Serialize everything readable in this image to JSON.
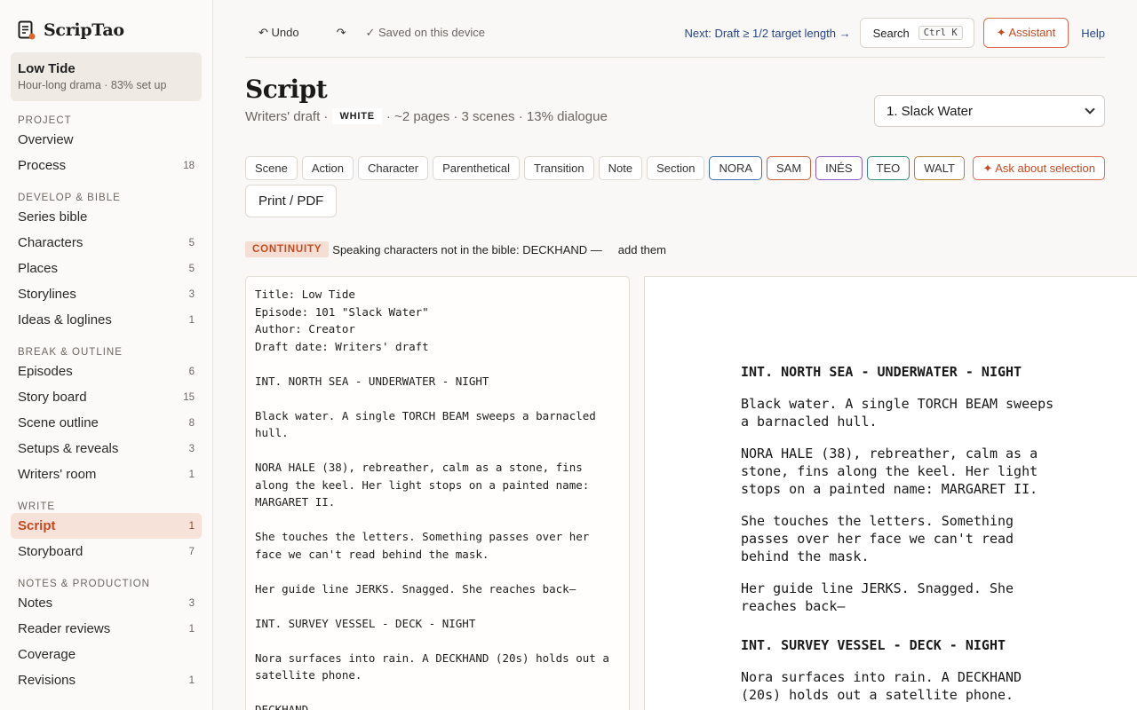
{
  "brand": {
    "name": "ScripTao",
    "accent": "#c44a21"
  },
  "project": {
    "title": "Low Tide",
    "subtitle": "Hour-long drama · 83% set up"
  },
  "nav": [
    {
      "section": "Project",
      "items": [
        {
          "label": "Overview",
          "count": ""
        },
        {
          "label": "Process",
          "count": "18"
        }
      ]
    },
    {
      "section": "Develop & Bible",
      "items": [
        {
          "label": "Series bible",
          "count": ""
        },
        {
          "label": "Characters",
          "count": "5"
        },
        {
          "label": "Places",
          "count": "5"
        },
        {
          "label": "Storylines",
          "count": "3"
        },
        {
          "label": "Ideas & loglines",
          "count": "1"
        }
      ]
    },
    {
      "section": "Break & Outline",
      "items": [
        {
          "label": "Episodes",
          "count": "6"
        },
        {
          "label": "Story board",
          "count": "15"
        },
        {
          "label": "Scene outline",
          "count": "8"
        },
        {
          "label": "Setups & reveals",
          "count": "3"
        },
        {
          "label": "Writers' room",
          "count": "1"
        }
      ]
    },
    {
      "section": "Write",
      "items": [
        {
          "label": "Script",
          "count": "1",
          "active": true
        },
        {
          "label": "Storyboard",
          "count": "7"
        }
      ]
    },
    {
      "section": "Notes & Production",
      "items": [
        {
          "label": "Notes",
          "count": "3"
        },
        {
          "label": "Reader reviews",
          "count": "1"
        },
        {
          "label": "Coverage",
          "count": ""
        },
        {
          "label": "Revisions",
          "count": "1"
        }
      ]
    }
  ],
  "topbar": {
    "undo": "↶ Undo",
    "redo": "↷",
    "saved": "✓ Saved on this device",
    "next": "Next: Draft ≥ 1/2 target length →",
    "search": "Search",
    "search_kbd": "Ctrl K",
    "assistant": "✦ Assistant",
    "help": "Help"
  },
  "page": {
    "title": "Script",
    "draft": "Writers' draft ·",
    "revision": "WHITE",
    "stats": "· ~2 pages · 3 scenes · 13% dialogue",
    "scene_selected": "1. Slack Water"
  },
  "toolbar": {
    "elements": [
      "Scene",
      "Action",
      "Character",
      "Parenthetical",
      "Transition",
      "Note",
      "Section"
    ],
    "characters": [
      {
        "name": "NORA",
        "color": "#3a6fb0"
      },
      {
        "name": "SAM",
        "color": "#c8643c"
      },
      {
        "name": "INÉS",
        "color": "#8a5cc4"
      },
      {
        "name": "TEO",
        "color": "#2f8c7c"
      },
      {
        "name": "WALT",
        "color": "#b8843a"
      }
    ],
    "ask": "✦ Ask about selection",
    "print": "Print / PDF"
  },
  "continuity": {
    "badge": "CONTINUITY",
    "message": "Speaking characters not in the bible: DECKHAND —",
    "action": "add them"
  },
  "editor_text": "Title: Low Tide\nEpisode: 101 \"Slack Water\"\nAuthor: Creator\nDraft date: Writers' draft\n\nINT. NORTH SEA - UNDERWATER - NIGHT\n\nBlack water. A single TORCH BEAM sweeps a barnacled hull.\n\nNORA HALE (38), rebreather, calm as a stone, fins along the keel. Her light stops on a painted name: MARGARET II.\n\nShe touches the letters. Something passes over her face we can't read behind the mask.\n\nHer guide line JERKS. Snagged. She reaches back—\n\nINT. SURVEY VESSEL - DECK - NIGHT\n\nNora surfaces into rain. A DECKHAND (20s) holds out a satellite phone.\n\nDECKHAND",
  "preview": {
    "heading1": "INT. NORTH SEA - UNDERWATER - NIGHT",
    "action1": "Black water. A single TORCH BEAM sweeps\na barnacled hull.",
    "action2": "NORA HALE (38), rebreather, calm as a\nstone, fins along the keel. Her light\nstops on a painted name: MARGARET II.",
    "action3": "She touches the letters. Something\npasses over her face we can't read\nbehind the mask.",
    "action4": "Her guide line JERKS. Snagged. She\nreaches back—",
    "heading2": "INT. SURVEY VESSEL - DECK - NIGHT",
    "action5": "Nora surfaces into rain. A DECKHAND\n(20s) holds out a satellite phone."
  }
}
